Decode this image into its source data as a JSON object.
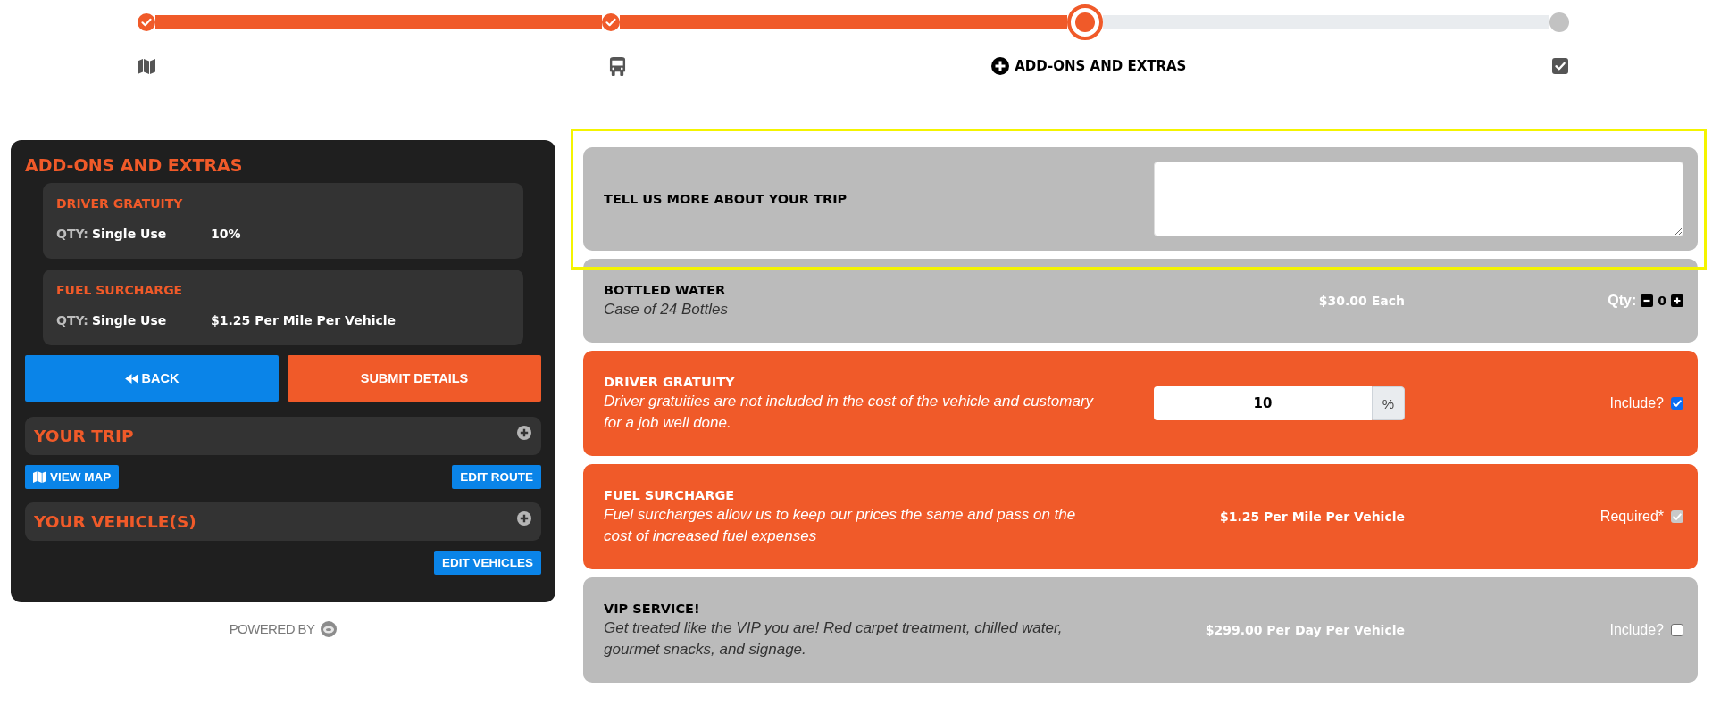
{
  "progress": {
    "steps": [
      {
        "completed": true,
        "selected": false
      },
      {
        "completed": true,
        "selected": false
      },
      {
        "completed": false,
        "selected": true,
        "label": "ADD-ONS AND EXTRAS"
      },
      {
        "completed": false,
        "selected": false
      }
    ]
  },
  "summary": {
    "title": "ADD-ONS AND EXTRAS",
    "items": [
      {
        "name": "DRIVER GRATUITY",
        "qty_label": "QTY:",
        "qty": "Single Use",
        "price": "10%"
      },
      {
        "name": "FUEL SURCHARGE",
        "qty_label": "QTY:",
        "qty": "Single Use",
        "price": "$1.25 Per Mile Per Vehicle"
      }
    ],
    "buttons": [
      {
        "kind": "back",
        "label": "BACK"
      },
      {
        "kind": "submit",
        "label": "SUBMIT DETAILS"
      }
    ],
    "sections": [
      {
        "title": "YOUR TRIP",
        "expanded": false,
        "actions": [
          {
            "kind": "map",
            "label": "VIEW MAP"
          },
          {
            "kind": "edit",
            "label": "EDIT ROUTE"
          }
        ]
      },
      {
        "title": "YOUR VEHICLE(S)",
        "expanded": false,
        "actions": [
          {
            "kind": "edit",
            "label": "EDIT VEHICLES"
          }
        ]
      }
    ]
  },
  "footer": {
    "powered_by": "POWERED BY"
  },
  "addons": [
    {
      "kind": "notes",
      "title": "TELL US MORE ABOUT YOUR TRIP",
      "highlighted": true,
      "selected": false
    },
    {
      "kind": "quantity",
      "title": "BOTTLED WATER",
      "description": "Case of 24 Bottles",
      "price": "$30.00 Each",
      "qty_label": "Qty:",
      "qty": "0",
      "highlighted": false,
      "selected": false
    },
    {
      "kind": "percent",
      "title": "DRIVER GRATUITY",
      "description": "Driver gratuities are not included in the cost of the vehicle and customary for a job well done.",
      "value": "10",
      "unit": "%",
      "option_label": "Include?",
      "checked": true,
      "disabled": false,
      "highlighted": false,
      "selected": true
    },
    {
      "kind": "option",
      "title": "FUEL SURCHARGE",
      "description": "Fuel surcharges allow us to keep our prices the same and pass on the cost of increased fuel expenses",
      "price": "$1.25 Per Mile Per Vehicle",
      "option_label": "Required*",
      "checked": true,
      "disabled": true,
      "highlighted": false,
      "selected": true
    },
    {
      "kind": "option",
      "title": "VIP SERVICE!",
      "description": "Get treated like the VIP you are! Red carpet treatment, chilled water, gourmet snacks, and signage.",
      "price": "$299.00 Per Day Per Vehicle",
      "option_label": "Include?",
      "checked": false,
      "disabled": false,
      "highlighted": false,
      "selected": false
    }
  ]
}
